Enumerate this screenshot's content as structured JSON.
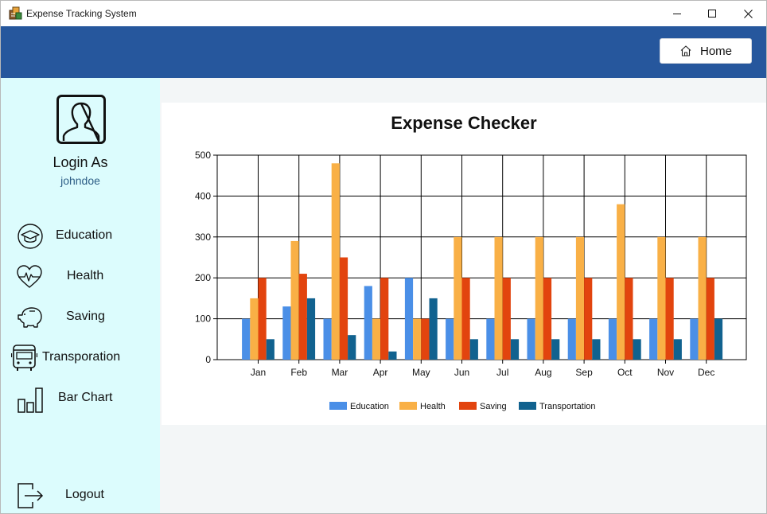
{
  "window": {
    "title": "Expense Tracking System"
  },
  "topbar": {
    "home_label": "Home"
  },
  "sidebar": {
    "login_label": "Login As",
    "username": "johndoe",
    "items": [
      {
        "label": "Education",
        "icon": "graduation-cap-icon"
      },
      {
        "label": "Health",
        "icon": "heart-pulse-icon"
      },
      {
        "label": "Saving",
        "icon": "piggy-bank-icon"
      },
      {
        "label": "Transporation",
        "icon": "bus-icon"
      },
      {
        "label": "Bar Chart",
        "icon": "bar-chart-icon"
      }
    ],
    "logout_label": "Logout"
  },
  "chart_data": {
    "type": "bar",
    "title": "Expense Checker",
    "categories": [
      "Jan",
      "Feb",
      "Mar",
      "Apr",
      "May",
      "Jun",
      "Jul",
      "Aug",
      "Sep",
      "Oct",
      "Nov",
      "Dec"
    ],
    "ylim": [
      0,
      500
    ],
    "yticks": [
      0,
      100,
      200,
      300,
      400,
      500
    ],
    "grid": true,
    "legend_position": "bottom",
    "series": [
      {
        "name": "Education",
        "color": "#4a8fe7",
        "values": [
          100,
          130,
          100,
          180,
          200,
          100,
          100,
          100,
          100,
          100,
          100,
          100
        ]
      },
      {
        "name": "Health",
        "color": "#f9b046",
        "values": [
          150,
          290,
          480,
          100,
          100,
          300,
          300,
          300,
          300,
          380,
          300,
          300
        ]
      },
      {
        "name": "Saving",
        "color": "#e2440e",
        "values": [
          200,
          210,
          250,
          200,
          100,
          200,
          200,
          200,
          200,
          200,
          200,
          200
        ]
      },
      {
        "name": "Transportation",
        "color": "#11628f",
        "values": [
          50,
          150,
          60,
          20,
          150,
          50,
          50,
          50,
          50,
          50,
          50,
          100
        ]
      }
    ]
  }
}
